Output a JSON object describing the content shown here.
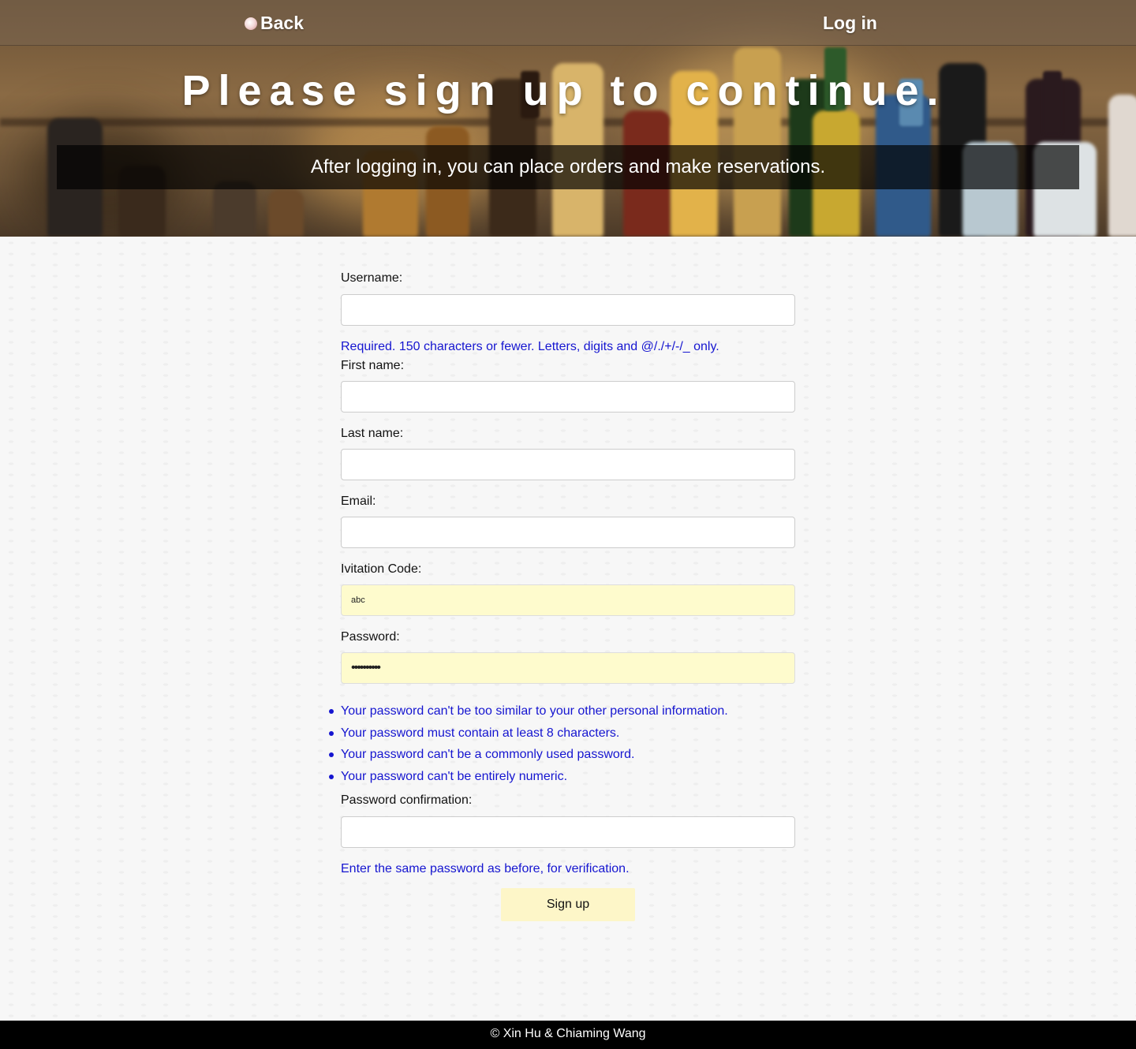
{
  "nav": {
    "back_label": "Back",
    "login_label": "Log in"
  },
  "hero": {
    "title": "Please sign up to continue.",
    "subtitle": "After logging in, you can place orders and make reservations."
  },
  "form": {
    "username": {
      "label": "Username:",
      "value": "",
      "help": "Required. 150 characters or fewer. Letters, digits and @/./+/-/_ only."
    },
    "first_name": {
      "label": "First name:",
      "value": ""
    },
    "last_name": {
      "label": "Last name:",
      "value": ""
    },
    "email": {
      "label": "Email:",
      "value": ""
    },
    "invitation_code": {
      "label": "Ivitation Code:",
      "value": "abc"
    },
    "password": {
      "label": "Password:",
      "value": "••••••••••",
      "rules": [
        "Your password can't be too similar to your other personal information.",
        "Your password must contain at least 8 characters.",
        "Your password can't be a commonly used password.",
        "Your password can't be entirely numeric."
      ]
    },
    "password_confirmation": {
      "label": "Password confirmation:",
      "value": "",
      "help": "Enter the same password as before, for verification."
    },
    "submit_label": "Sign up"
  },
  "footer": {
    "text": "© Xin Hu & Chiaming Wang"
  },
  "colors": {
    "help_text": "#1515d0",
    "autofill_bg": "#fefbcd",
    "button_bg": "#fdf6c8",
    "footer_bg": "#000000"
  }
}
